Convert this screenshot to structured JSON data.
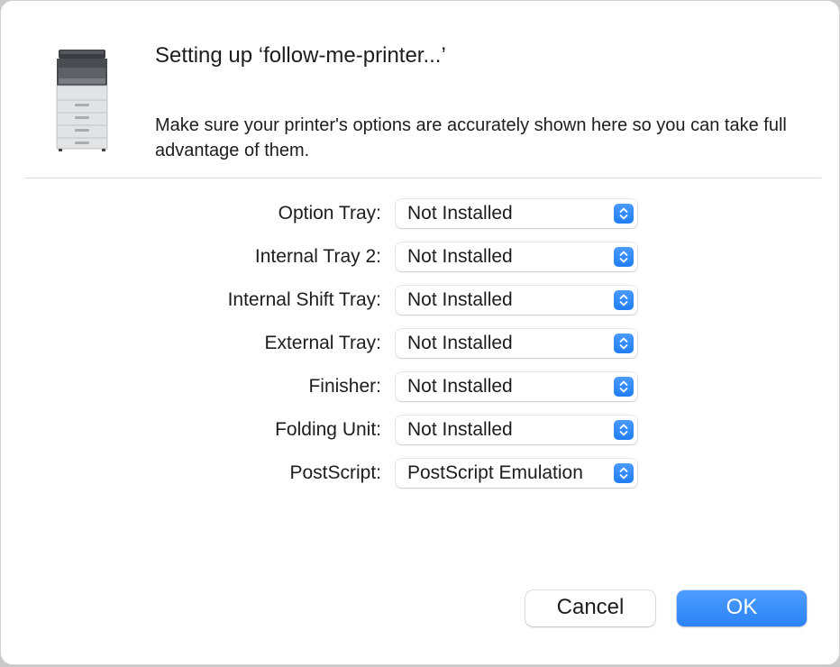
{
  "dialog": {
    "title": "Setting up ‘follow-me-printer...’",
    "message": "Make sure your printer's options are accurately shown here so you can take full advantage of them.",
    "printer_icon": "multifunction-printer-icon"
  },
  "options": [
    {
      "label": "Option Tray:",
      "value": "Not Installed"
    },
    {
      "label": "Internal Tray 2:",
      "value": "Not Installed"
    },
    {
      "label": "Internal Shift Tray:",
      "value": "Not Installed"
    },
    {
      "label": "External Tray:",
      "value": "Not Installed"
    },
    {
      "label": "Finisher:",
      "value": "Not Installed"
    },
    {
      "label": "Folding Unit:",
      "value": "Not Installed"
    },
    {
      "label": "PostScript:",
      "value": "PostScript Emulation"
    }
  ],
  "buttons": {
    "cancel": "Cancel",
    "ok": "OK"
  },
  "colors": {
    "accent": "#2b83f6",
    "stepper": "#1f7df5"
  }
}
